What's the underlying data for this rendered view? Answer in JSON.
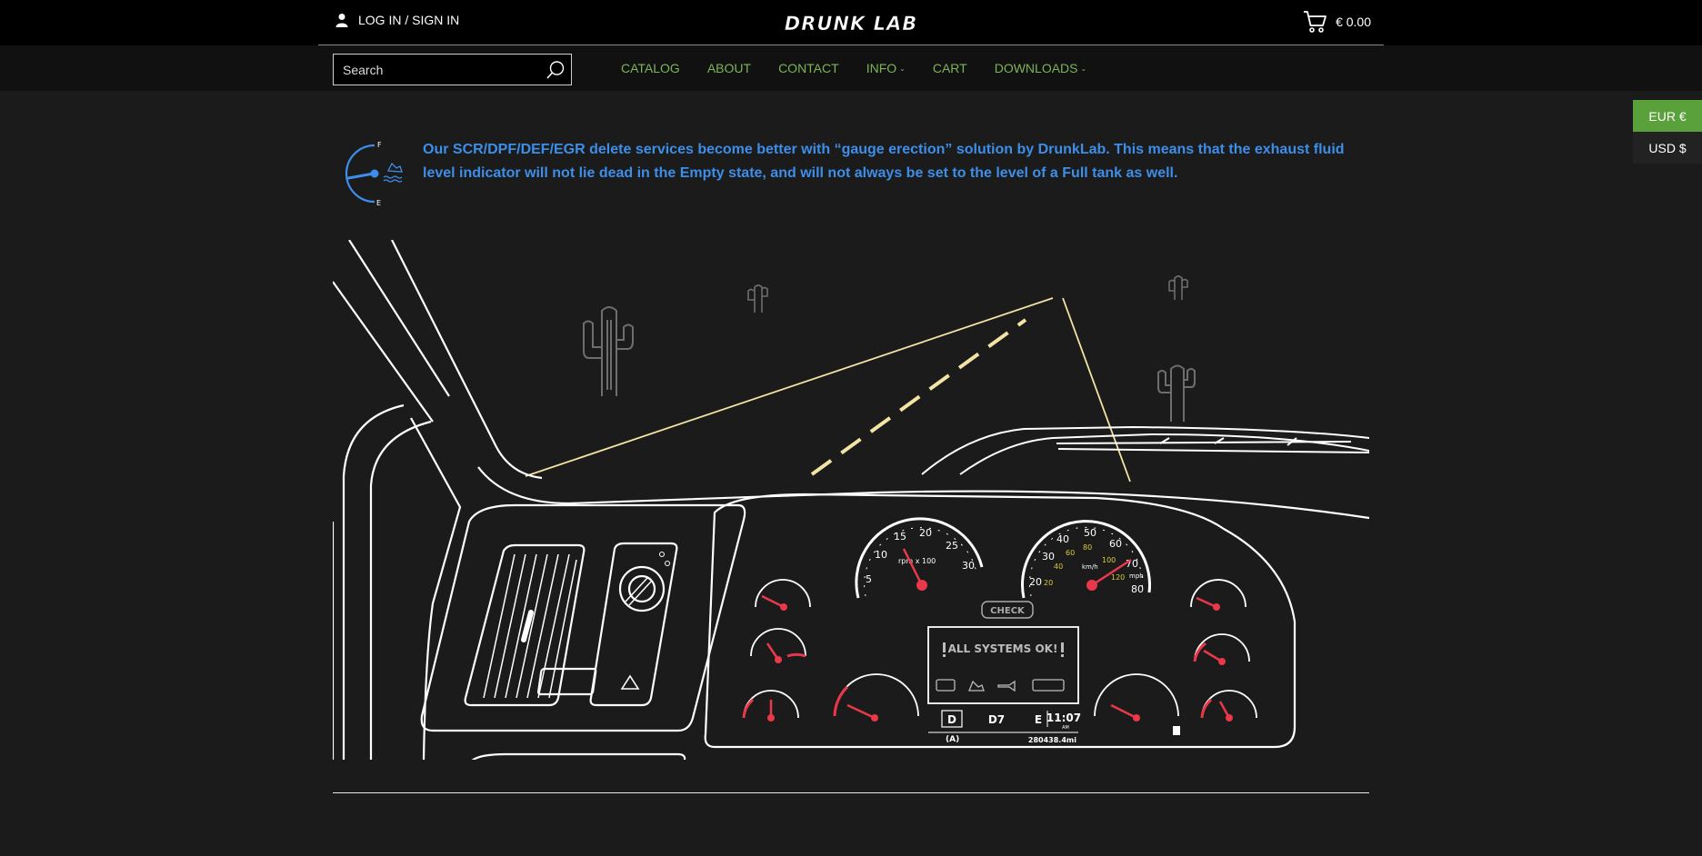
{
  "header": {
    "login_label": "LOG IN / SIGN IN",
    "logo_text": "DRUNK LAB",
    "cart_total": "€ 0.00"
  },
  "search": {
    "placeholder": "Search"
  },
  "nav": {
    "items": [
      {
        "label": "CATALOG",
        "dropdown": false
      },
      {
        "label": "ABOUT",
        "dropdown": false
      },
      {
        "label": "CONTACT",
        "dropdown": false
      },
      {
        "label": "INFO",
        "dropdown": true
      },
      {
        "label": "CART",
        "dropdown": false
      },
      {
        "label": "DOWNLOADS",
        "dropdown": true
      }
    ]
  },
  "currency": {
    "options": [
      "EUR €",
      "USD $"
    ],
    "selected": "EUR €"
  },
  "info": {
    "text": "Our SCR/DPF/DEF/EGR delete services become better with “gauge erection” solution by DrunkLab. This means that the exhaust fluid level indicator will not lie dead in the Empty state, and will not always be set to the level of a Full tank as well.",
    "gauge_full": "F",
    "gauge_empty": "E"
  },
  "dashboard": {
    "rpm_ticks": [
      "5",
      "10",
      "15",
      "20",
      "25",
      "30"
    ],
    "rpm_unit": "rpm x 100",
    "speed_mph_ticks": [
      "20",
      "30",
      "40",
      "50",
      "60",
      "70",
      "80"
    ],
    "speed_kmh_ticks": [
      "20",
      "40",
      "60",
      "80",
      "100",
      "120"
    ],
    "speed_kmh_unit": "km/h",
    "speed_mph_unit": "mph",
    "check_label": "CHECK",
    "status_text": "ALL SYSTEMS OK!",
    "gear_left": "D",
    "gear_center": "D7",
    "gear_right": "E",
    "clock": "11:07",
    "clock_period": "AM",
    "mode": "(A)",
    "odometer": "280438.4mi"
  },
  "colors": {
    "accent_green": "#7db457",
    "currency_active": "#5aa13b",
    "info_blue": "#3d8ee8",
    "needle_red": "#e8384a",
    "road_yellow": "#f3e3a4",
    "kmh_yellow": "#d8cc3a"
  }
}
